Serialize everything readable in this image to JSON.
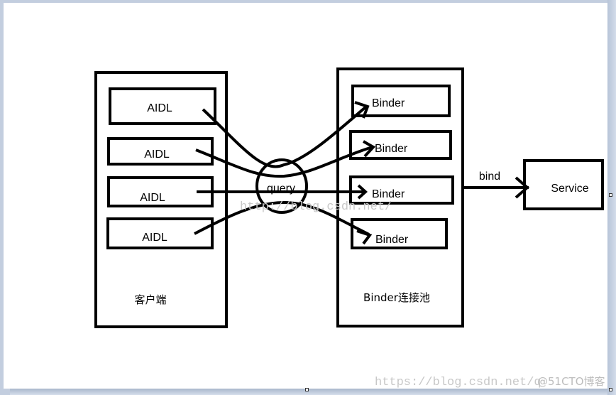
{
  "diagram": {
    "client": {
      "label": "客户端",
      "items": [
        {
          "label": "AIDL"
        },
        {
          "label": "AIDL"
        },
        {
          "label": "AIDL"
        },
        {
          "label": "AIDL"
        }
      ]
    },
    "pool": {
      "label": "Binder连接池",
      "items": [
        {
          "label": "Binder"
        },
        {
          "label": "Binder"
        },
        {
          "label": "Binder"
        },
        {
          "label": "Binder"
        }
      ]
    },
    "hub": {
      "label": "query"
    },
    "edge_bind": {
      "label": "bind"
    },
    "service": {
      "label": "Service"
    }
  },
  "watermarks": {
    "center": "http://blog.csdn.net/",
    "bottom_url": "https://blog.csdn.net/q",
    "bottom_tag": "@51CTO博客"
  }
}
